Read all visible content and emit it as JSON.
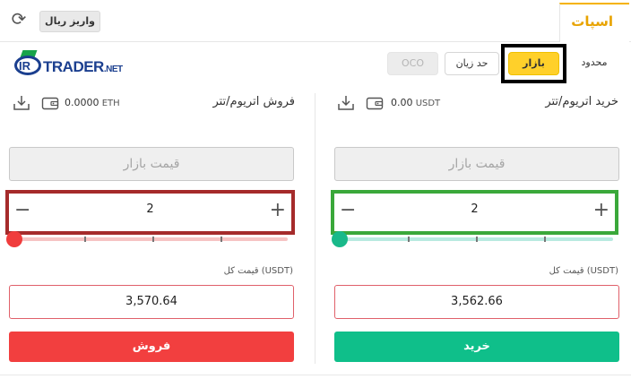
{
  "header": {
    "tab_spot": "اسپات",
    "deposit_button": "واریز ریال"
  },
  "logo": {
    "text_ir": "IR",
    "text_name": "TRADER",
    "text_net": ".NET"
  },
  "order_types": {
    "limit": "محدود",
    "market": "بازار",
    "stop_limit": "حد زیان",
    "oco": "OCO"
  },
  "buy": {
    "title": "خرید اتریوم/تتر",
    "balance_value": "0.00",
    "balance_unit": "USDT",
    "price_placeholder": "قیمت بازار",
    "amount": "2",
    "slider_fraction": 0,
    "total_label": "قیمت کل (USDT)",
    "total_value": "3,562.66",
    "button_label": "خرید"
  },
  "sell": {
    "title": "فروش اتریوم/تتر",
    "balance_value": "0.0000",
    "balance_unit": "ETH",
    "price_placeholder": "قیمت بازار",
    "amount": "2",
    "slider_fraction": 0,
    "total_label": "قیمت کل (USDT)",
    "total_value": "3,570.64",
    "button_label": "فروش"
  },
  "colors": {
    "accent": "#ffd02a",
    "buy": "#0fbf8a",
    "sell": "#f23f3f"
  }
}
